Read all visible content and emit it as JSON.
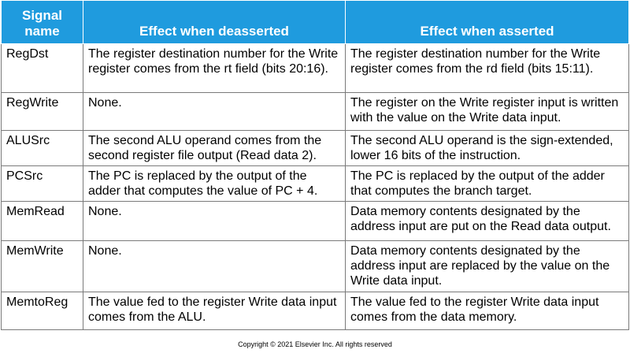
{
  "header": {
    "col1": "Signal name",
    "col2": "Effect when deasserted",
    "col3": "Effect when asserted"
  },
  "rows": [
    {
      "signal": "RegDst",
      "deasserted": "The register destination number for the Write register comes from the rt field (bits 20:16).",
      "asserted": "The register destination number for the Write register comes from the rd field (bits 15:11)."
    },
    {
      "signal": "RegWrite",
      "deasserted": "None.",
      "asserted": "The register on the Write register input is written with the value on the Write data input."
    },
    {
      "signal": "ALUSrc",
      "deasserted": "The second ALU operand comes from the second register file output (Read data 2).",
      "asserted": "The second ALU operand is the sign-extended, lower 16 bits of the instruction."
    },
    {
      "signal": "PCSrc",
      "deasserted": "The PC is replaced by the output of the adder that computes the value of PC + 4.",
      "asserted": "The PC is replaced by the output of the adder that computes the branch target."
    },
    {
      "signal": "MemRead",
      "deasserted": "None.",
      "asserted": "Data memory contents designated by the address input are put on the Read data output."
    },
    {
      "signal": "MemWrite",
      "deasserted": "None.",
      "asserted": "Data memory contents designated by the address input are replaced by the value on the Write data input."
    },
    {
      "signal": "MemtoReg",
      "deasserted": "The value fed to the register Write data input comes from the ALU.",
      "asserted": "The value fed to the register Write data input comes from the data memory."
    }
  ],
  "footer": "Copyright © 2021 Elsevier Inc. All rights reserved",
  "colors": {
    "header_bg": "#1f9bde",
    "header_text": "#ffffff",
    "border": "#7a7a7a"
  }
}
